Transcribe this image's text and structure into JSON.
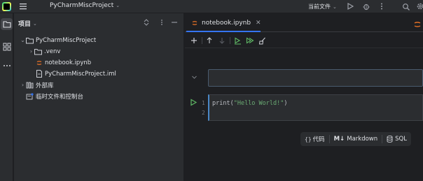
{
  "titlebar": {
    "project_name": "PyCharmMiscProject",
    "run_config": "当前文件"
  },
  "project_panel": {
    "title": "项目",
    "tree": [
      {
        "label": "PyCharmMiscProject"
      },
      {
        "label": ".venv"
      },
      {
        "label": "notebook.ipynb"
      },
      {
        "label": "PyCharmMiscProject.iml"
      },
      {
        "label": "外部库"
      },
      {
        "label": "临时文件和控制台"
      }
    ]
  },
  "editor": {
    "tab_label": "notebook.ipynb",
    "code_line": "print(\"Hello World!\")",
    "line_numbers": [
      "1",
      "2"
    ]
  },
  "add_cell_bar": {
    "code_label": "代码",
    "markdown_prefix": "M↓",
    "markdown_label": "Markdown",
    "sql_label": "SQL"
  },
  "colors": {
    "accent": "#3574f0",
    "run_green": "#5fb865",
    "string_green": "#6aab73"
  }
}
